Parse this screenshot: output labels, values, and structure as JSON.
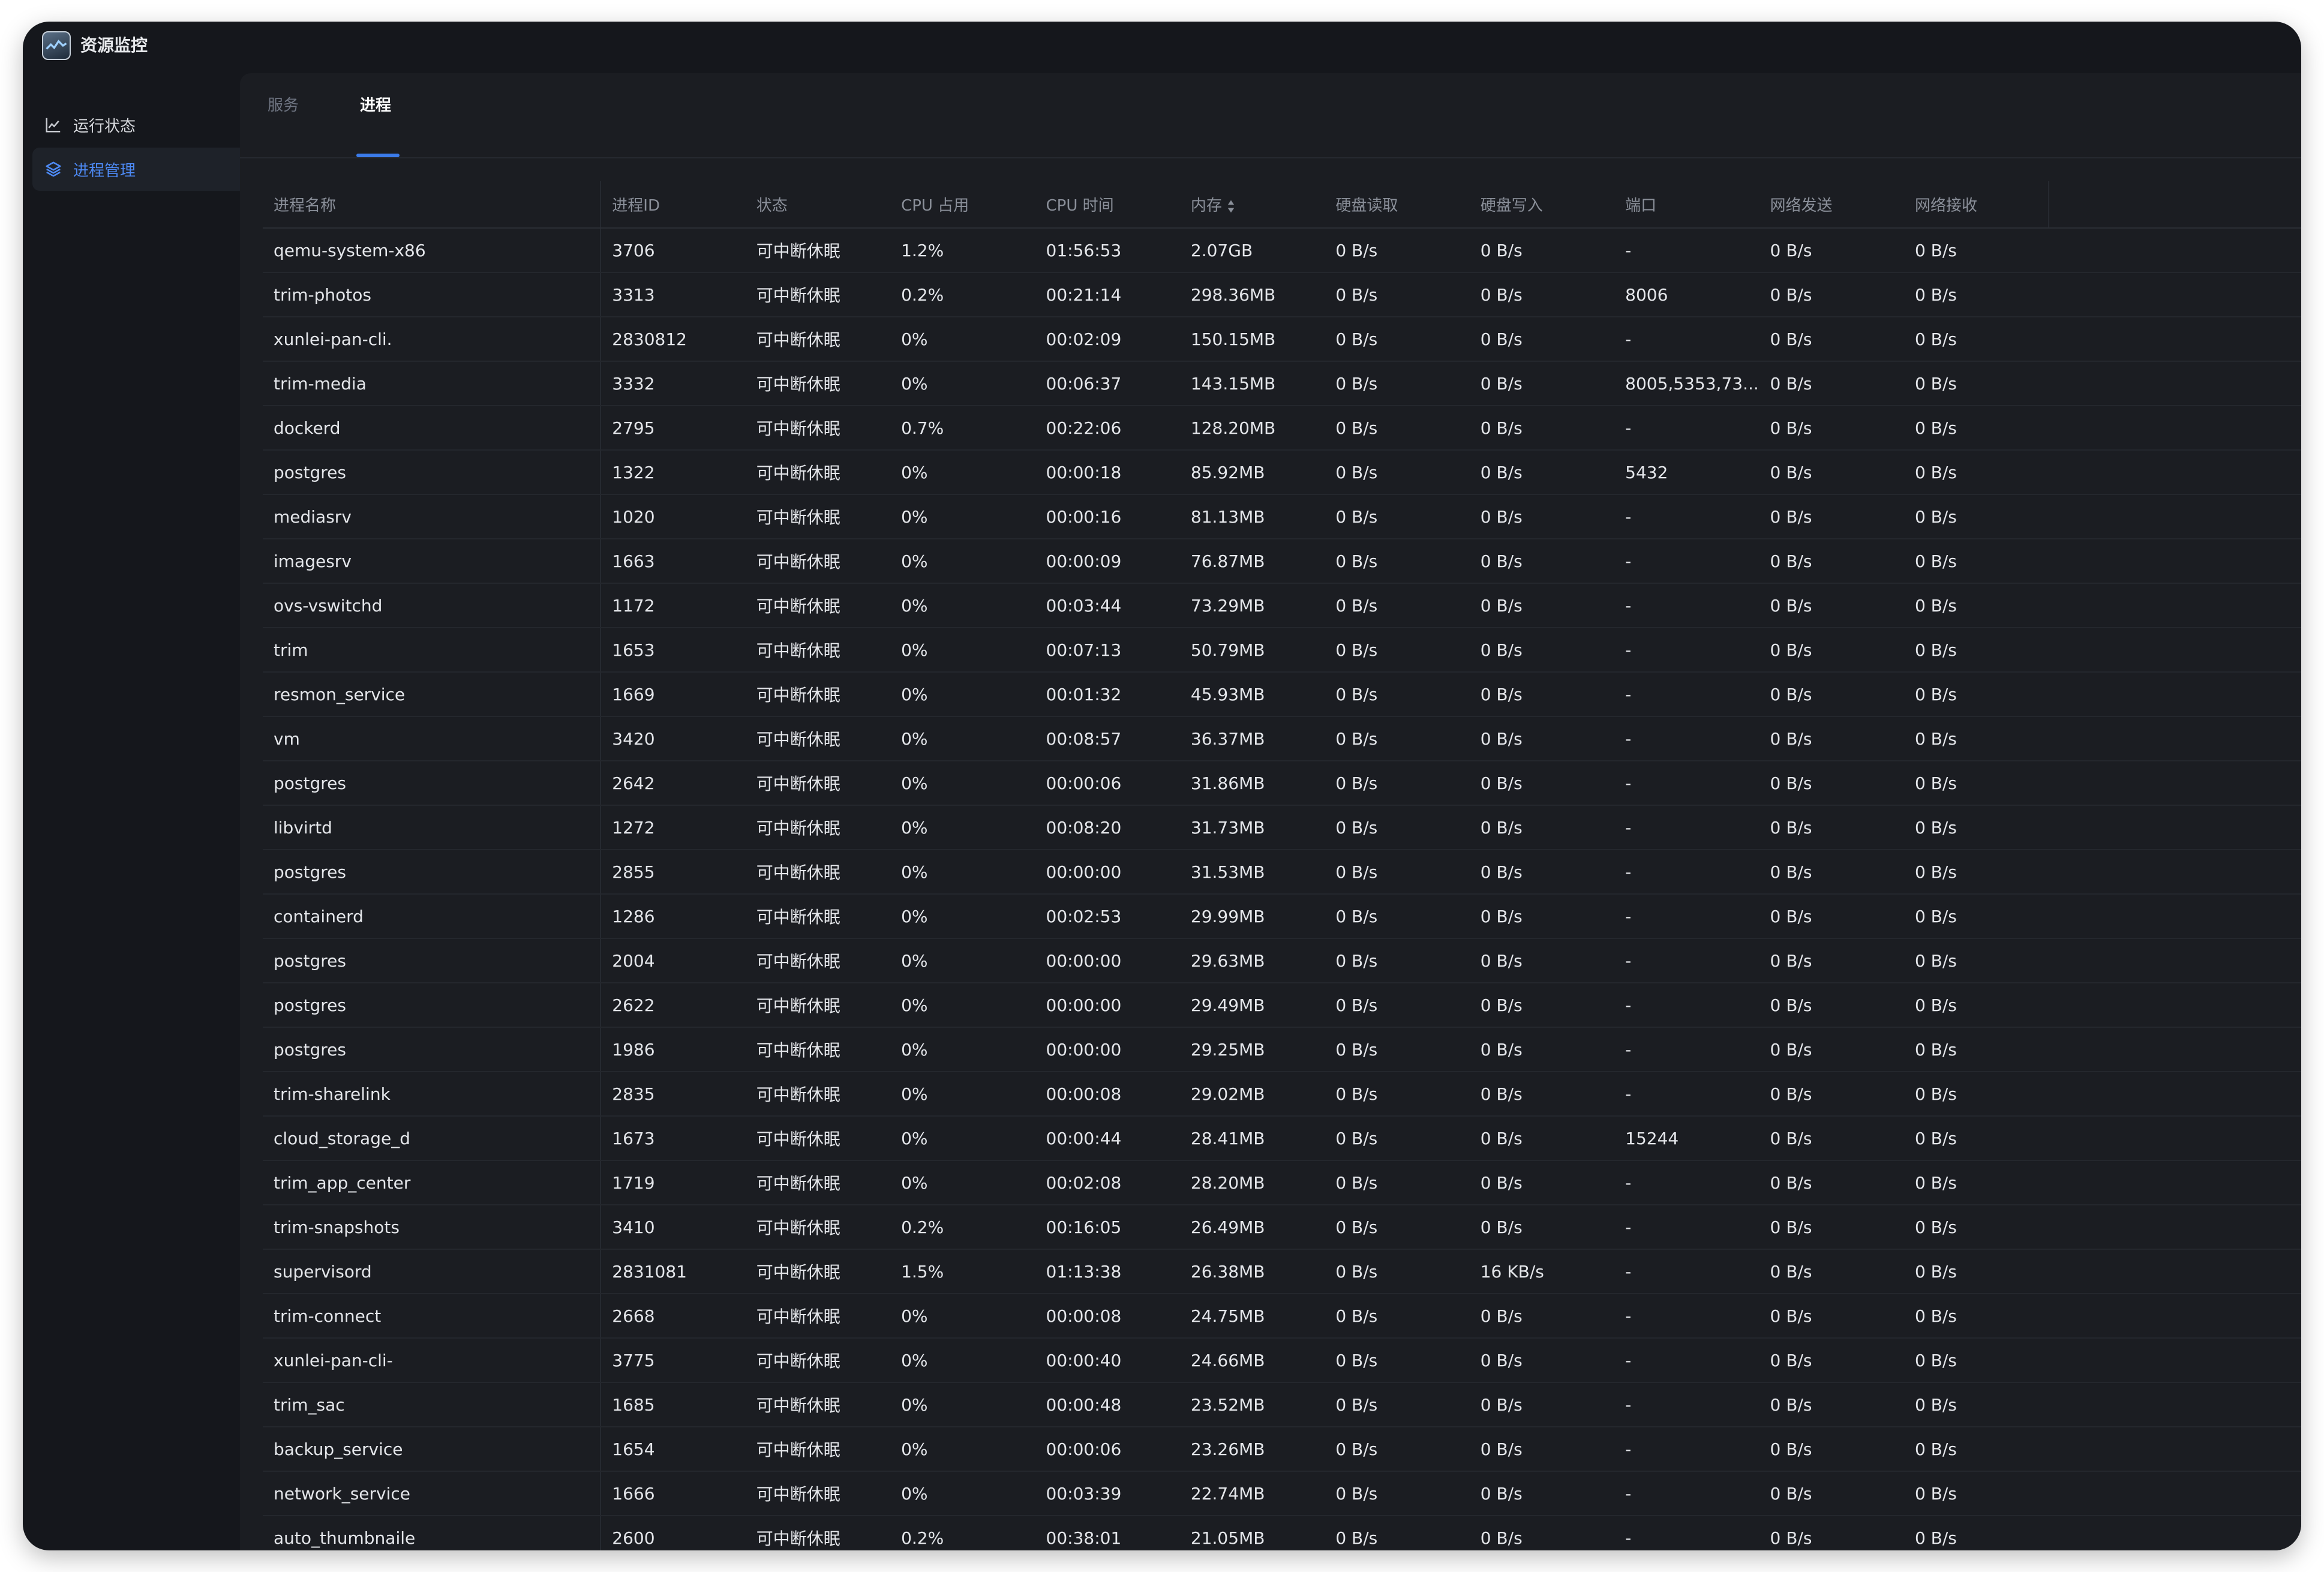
{
  "app": {
    "title": "资源监控"
  },
  "sidebar": {
    "items": [
      {
        "label": "运行状态",
        "icon": "line-chart-icon"
      },
      {
        "label": "进程管理",
        "icon": "layers-icon",
        "active": true
      }
    ]
  },
  "tabs": [
    {
      "label": "服务"
    },
    {
      "label": "进程",
      "active": true
    }
  ],
  "table": {
    "columns": [
      "进程名称",
      "进程ID",
      "状态",
      "CPU 占用",
      "CPU 时间",
      "内存",
      "硬盘读取",
      "硬盘写入",
      "端口",
      "网络发送",
      "网络接收"
    ],
    "sorted_column": "内存",
    "rows": [
      [
        "qemu-system-x86",
        "3706",
        "可中断休眠",
        "1.2%",
        "01:56:53",
        "2.07GB",
        "0 B/s",
        "0 B/s",
        "-",
        "0 B/s",
        "0 B/s"
      ],
      [
        "trim-photos",
        "3313",
        "可中断休眠",
        "0.2%",
        "00:21:14",
        "298.36MB",
        "0 B/s",
        "0 B/s",
        "8006",
        "0 B/s",
        "0 B/s"
      ],
      [
        "xunlei-pan-cli.",
        "2830812",
        "可中断休眠",
        "0%",
        "00:02:09",
        "150.15MB",
        "0 B/s",
        "0 B/s",
        "-",
        "0 B/s",
        "0 B/s"
      ],
      [
        "trim-media",
        "3332",
        "可中断休眠",
        "0%",
        "00:06:37",
        "143.15MB",
        "0 B/s",
        "0 B/s",
        "8005,5353,73...",
        "0 B/s",
        "0 B/s"
      ],
      [
        "dockerd",
        "2795",
        "可中断休眠",
        "0.7%",
        "00:22:06",
        "128.20MB",
        "0 B/s",
        "0 B/s",
        "-",
        "0 B/s",
        "0 B/s"
      ],
      [
        "postgres",
        "1322",
        "可中断休眠",
        "0%",
        "00:00:18",
        "85.92MB",
        "0 B/s",
        "0 B/s",
        "5432",
        "0 B/s",
        "0 B/s"
      ],
      [
        "mediasrv",
        "1020",
        "可中断休眠",
        "0%",
        "00:00:16",
        "81.13MB",
        "0 B/s",
        "0 B/s",
        "-",
        "0 B/s",
        "0 B/s"
      ],
      [
        "imagesrv",
        "1663",
        "可中断休眠",
        "0%",
        "00:00:09",
        "76.87MB",
        "0 B/s",
        "0 B/s",
        "-",
        "0 B/s",
        "0 B/s"
      ],
      [
        "ovs-vswitchd",
        "1172",
        "可中断休眠",
        "0%",
        "00:03:44",
        "73.29MB",
        "0 B/s",
        "0 B/s",
        "-",
        "0 B/s",
        "0 B/s"
      ],
      [
        "trim",
        "1653",
        "可中断休眠",
        "0%",
        "00:07:13",
        "50.79MB",
        "0 B/s",
        "0 B/s",
        "-",
        "0 B/s",
        "0 B/s"
      ],
      [
        "resmon_service",
        "1669",
        "可中断休眠",
        "0%",
        "00:01:32",
        "45.93MB",
        "0 B/s",
        "0 B/s",
        "-",
        "0 B/s",
        "0 B/s"
      ],
      [
        "vm",
        "3420",
        "可中断休眠",
        "0%",
        "00:08:57",
        "36.37MB",
        "0 B/s",
        "0 B/s",
        "-",
        "0 B/s",
        "0 B/s"
      ],
      [
        "postgres",
        "2642",
        "可中断休眠",
        "0%",
        "00:00:06",
        "31.86MB",
        "0 B/s",
        "0 B/s",
        "-",
        "0 B/s",
        "0 B/s"
      ],
      [
        "libvirtd",
        "1272",
        "可中断休眠",
        "0%",
        "00:08:20",
        "31.73MB",
        "0 B/s",
        "0 B/s",
        "-",
        "0 B/s",
        "0 B/s"
      ],
      [
        "postgres",
        "2855",
        "可中断休眠",
        "0%",
        "00:00:00",
        "31.53MB",
        "0 B/s",
        "0 B/s",
        "-",
        "0 B/s",
        "0 B/s"
      ],
      [
        "containerd",
        "1286",
        "可中断休眠",
        "0%",
        "00:02:53",
        "29.99MB",
        "0 B/s",
        "0 B/s",
        "-",
        "0 B/s",
        "0 B/s"
      ],
      [
        "postgres",
        "2004",
        "可中断休眠",
        "0%",
        "00:00:00",
        "29.63MB",
        "0 B/s",
        "0 B/s",
        "-",
        "0 B/s",
        "0 B/s"
      ],
      [
        "postgres",
        "2622",
        "可中断休眠",
        "0%",
        "00:00:00",
        "29.49MB",
        "0 B/s",
        "0 B/s",
        "-",
        "0 B/s",
        "0 B/s"
      ],
      [
        "postgres",
        "1986",
        "可中断休眠",
        "0%",
        "00:00:00",
        "29.25MB",
        "0 B/s",
        "0 B/s",
        "-",
        "0 B/s",
        "0 B/s"
      ],
      [
        "trim-sharelink",
        "2835",
        "可中断休眠",
        "0%",
        "00:00:08",
        "29.02MB",
        "0 B/s",
        "0 B/s",
        "-",
        "0 B/s",
        "0 B/s"
      ],
      [
        "cloud_storage_d",
        "1673",
        "可中断休眠",
        "0%",
        "00:00:44",
        "28.41MB",
        "0 B/s",
        "0 B/s",
        "15244",
        "0 B/s",
        "0 B/s"
      ],
      [
        "trim_app_center",
        "1719",
        "可中断休眠",
        "0%",
        "00:02:08",
        "28.20MB",
        "0 B/s",
        "0 B/s",
        "-",
        "0 B/s",
        "0 B/s"
      ],
      [
        "trim-snapshots",
        "3410",
        "可中断休眠",
        "0.2%",
        "00:16:05",
        "26.49MB",
        "0 B/s",
        "0 B/s",
        "-",
        "0 B/s",
        "0 B/s"
      ],
      [
        "supervisord",
        "2831081",
        "可中断休眠",
        "1.5%",
        "01:13:38",
        "26.38MB",
        "0 B/s",
        "16 KB/s",
        "-",
        "0 B/s",
        "0 B/s"
      ],
      [
        "trim-connect",
        "2668",
        "可中断休眠",
        "0%",
        "00:00:08",
        "24.75MB",
        "0 B/s",
        "0 B/s",
        "-",
        "0 B/s",
        "0 B/s"
      ],
      [
        "xunlei-pan-cli-",
        "3775",
        "可中断休眠",
        "0%",
        "00:00:40",
        "24.66MB",
        "0 B/s",
        "0 B/s",
        "-",
        "0 B/s",
        "0 B/s"
      ],
      [
        "trim_sac",
        "1685",
        "可中断休眠",
        "0%",
        "00:00:48",
        "23.52MB",
        "0 B/s",
        "0 B/s",
        "-",
        "0 B/s",
        "0 B/s"
      ],
      [
        "backup_service",
        "1654",
        "可中断休眠",
        "0%",
        "00:00:06",
        "23.26MB",
        "0 B/s",
        "0 B/s",
        "-",
        "0 B/s",
        "0 B/s"
      ],
      [
        "network_service",
        "1666",
        "可中断休眠",
        "0%",
        "00:03:39",
        "22.74MB",
        "0 B/s",
        "0 B/s",
        "-",
        "0 B/s",
        "0 B/s"
      ],
      [
        "auto_thumbnaile",
        "2600",
        "可中断休眠",
        "0.2%",
        "00:38:01",
        "21.05MB",
        "0 B/s",
        "0 B/s",
        "-",
        "0 B/s",
        "0 B/s"
      ]
    ]
  }
}
